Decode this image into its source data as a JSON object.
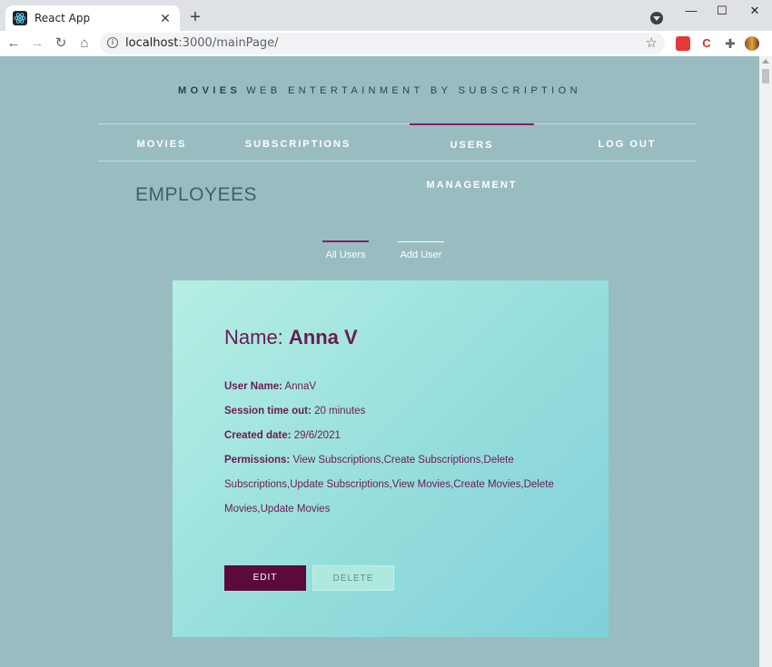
{
  "browser": {
    "tab_title": "React App",
    "url_host": "localhost",
    "url_path": ":3000/mainPage/"
  },
  "site": {
    "brand": "MOVIES",
    "tagline": "WEB ENTERTAINMENT BY SUBSCRIPTION"
  },
  "nav": {
    "items": [
      {
        "label": "MOVIES",
        "active": false
      },
      {
        "label": "SUBSCRIPTIONS",
        "active": false
      },
      {
        "label": "USERS MANAGEMENT",
        "active": true
      },
      {
        "label": "LOG OUT",
        "active": false
      }
    ]
  },
  "page": {
    "title": "EMPLOYEES"
  },
  "subtabs": [
    {
      "label": "All Users",
      "active": true
    },
    {
      "label": "Add User",
      "active": false
    }
  ],
  "user_card": {
    "name_label": "Name:",
    "name_value": "Anna V",
    "username_label": "User Name:",
    "username_value": "AnnaV",
    "session_label": "Session time out:",
    "session_value": "20 minutes",
    "created_label": "Created date:",
    "created_value": "29/6/2021",
    "permissions_label": "Permissions:",
    "permissions_value": "View Subscriptions,Create Subscriptions,Delete Subscriptions,Update Subscriptions,View Movies,Create Movies,Delete Movies,Update Movies",
    "edit_label": "EDIT",
    "delete_label": "DELETE"
  },
  "colors": {
    "page_bg": "#99bcc1",
    "accent": "#8a1f63",
    "edit_button": "#5c0a3e",
    "text_dark": "#6b1a52"
  }
}
